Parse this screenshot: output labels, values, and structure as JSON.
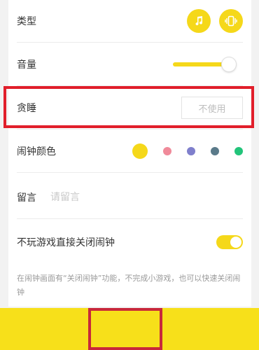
{
  "settings": {
    "type": {
      "label": "类型",
      "icons": [
        "music-note-icon",
        "vibrate-icon"
      ]
    },
    "volume": {
      "label": "音量",
      "level_percent": 88
    },
    "snooze": {
      "label": "贪睡",
      "value": "不使用"
    },
    "alarm_color": {
      "label": "闹钟颜色",
      "colors": [
        "#f5d81a",
        "#f08a9a",
        "#7f7fcc",
        "#5a7a8a",
        "#22c47a"
      ],
      "selected_index": 0
    },
    "note": {
      "label": "留言",
      "placeholder": "请留言"
    },
    "direct_close": {
      "label": "不玩游戏直接关闭闹钟",
      "enabled": true,
      "description": "在闹钟画面有“关闭闹钟”功能，不完成小游戏，也可以快速关闭闹钟"
    }
  },
  "colors": {
    "accent": "#f5d81a",
    "highlight_border": "#e11e2a"
  }
}
